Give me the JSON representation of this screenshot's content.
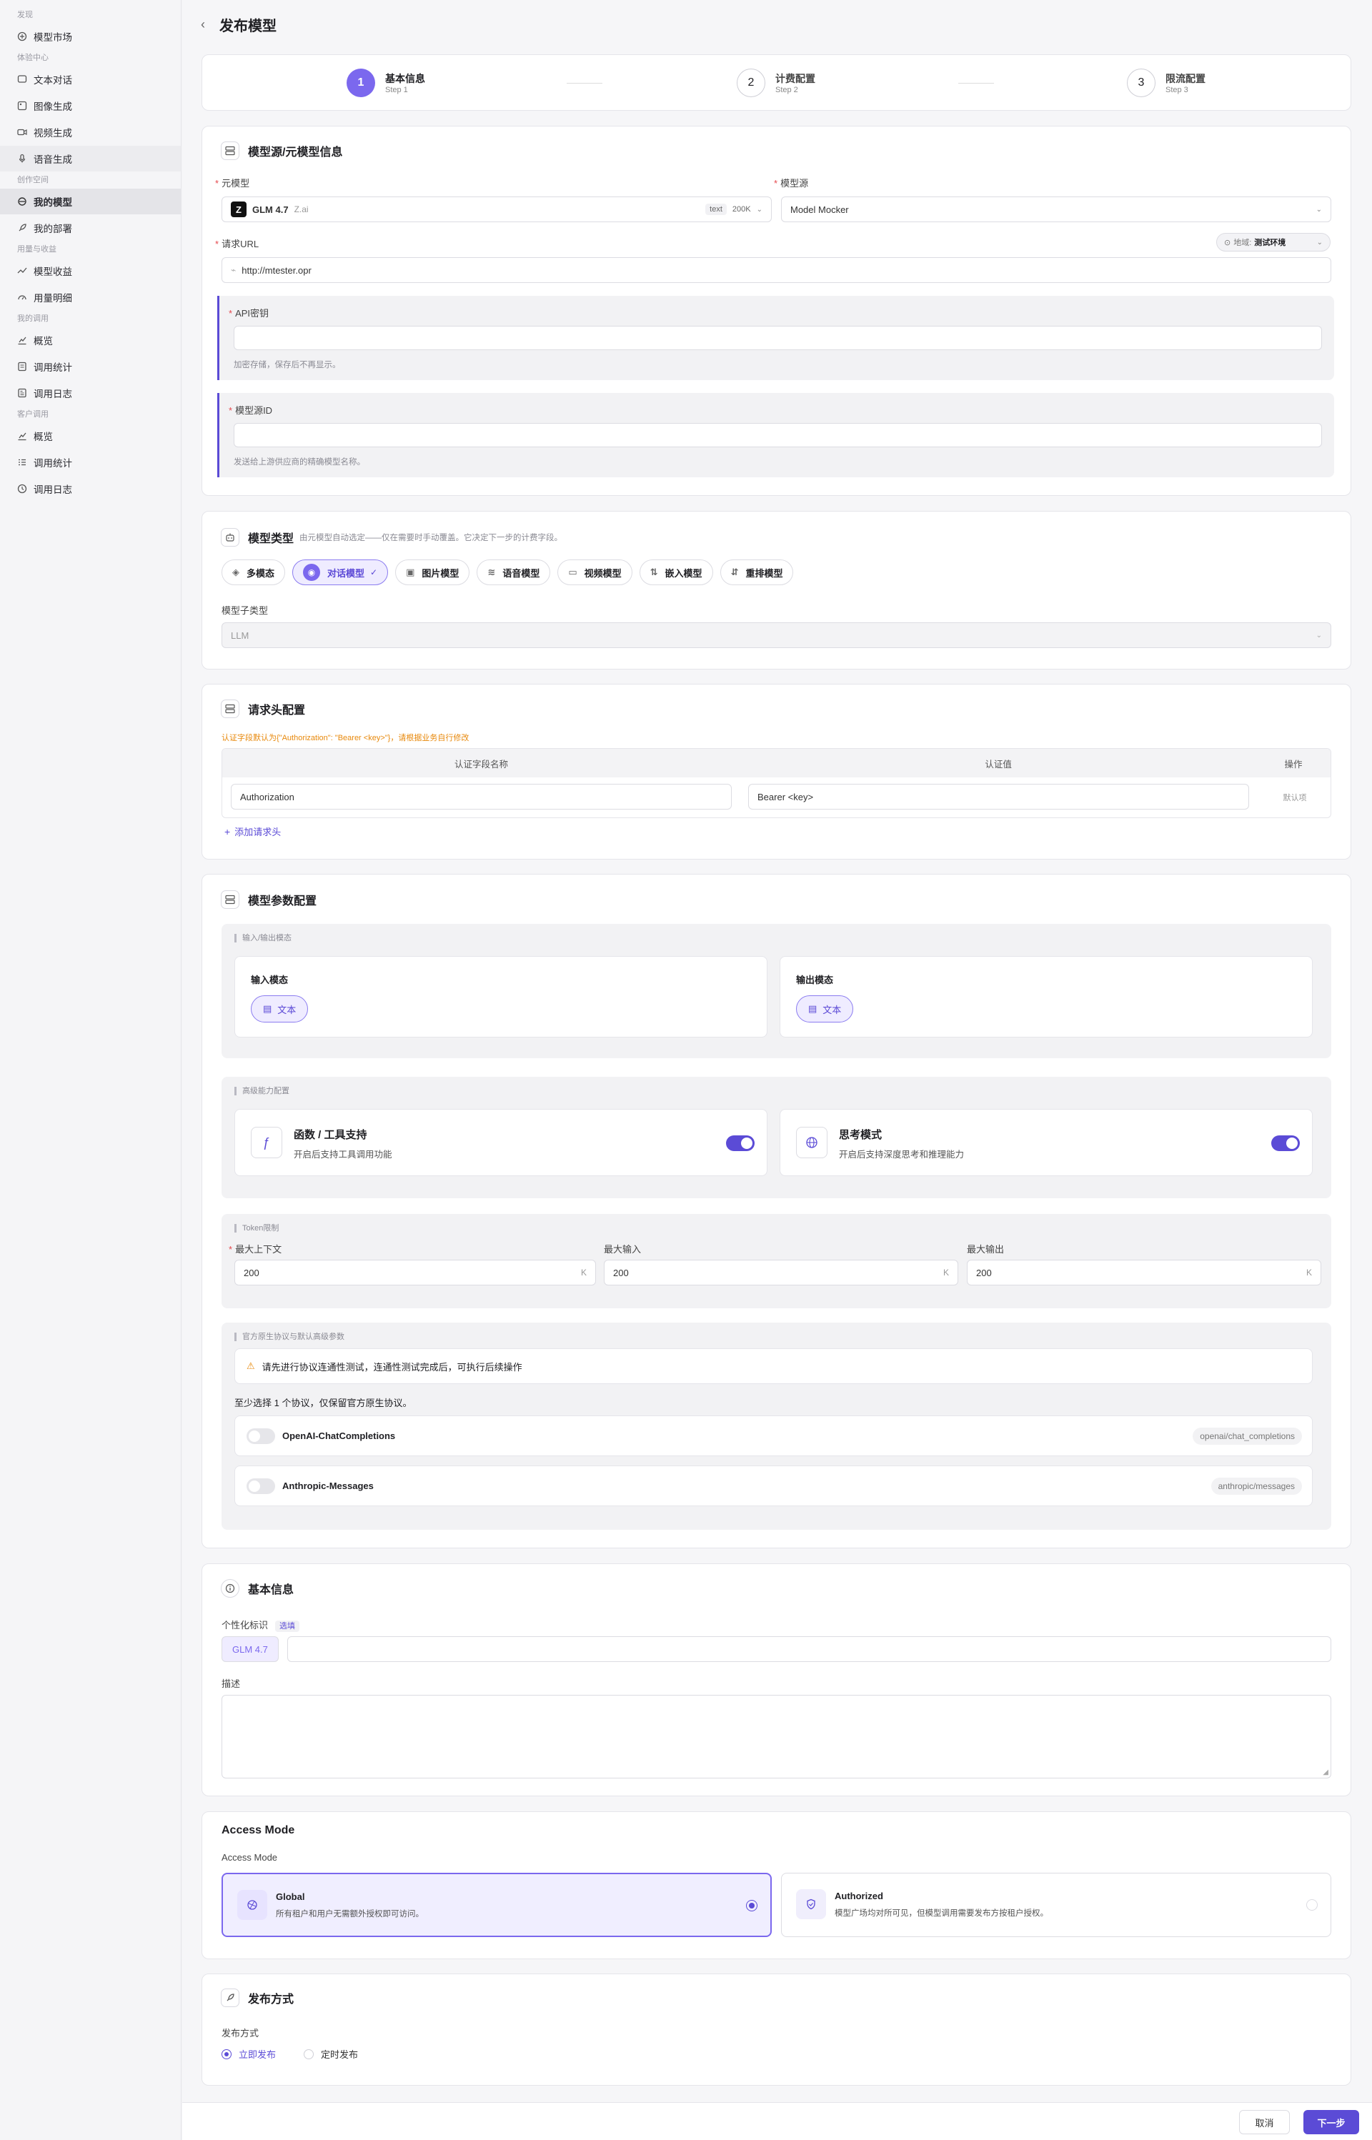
{
  "sidebar": {
    "groups": [
      {
        "label": "发现",
        "items": [
          {
            "label": "模型市场",
            "icon": "market-icon"
          }
        ]
      },
      {
        "label": "体验中心",
        "items": [
          {
            "label": "文本对话",
            "icon": "chat-icon"
          },
          {
            "label": "图像生成",
            "icon": "image-icon"
          },
          {
            "label": "视频生成",
            "icon": "video-icon"
          },
          {
            "label": "语音生成",
            "icon": "mic-icon"
          }
        ]
      },
      {
        "label": "创作空间",
        "items": [
          {
            "label": "我的模型",
            "icon": "model-icon"
          },
          {
            "label": "我的部署",
            "icon": "rocket-icon"
          }
        ]
      },
      {
        "label": "用量与收益",
        "items": [
          {
            "label": "模型收益",
            "icon": "trend-icon"
          },
          {
            "label": "用量明细",
            "icon": "gauge-icon"
          }
        ]
      },
      {
        "label": "我的调用",
        "items": [
          {
            "label": "概览",
            "icon": "chart-icon"
          },
          {
            "label": "调用统计",
            "icon": "table-icon"
          },
          {
            "label": "调用日志",
            "icon": "log-icon"
          }
        ]
      },
      {
        "label": "客户调用",
        "items": [
          {
            "label": "概览",
            "icon": "chart-icon"
          },
          {
            "label": "调用统计",
            "icon": "list-icon"
          },
          {
            "label": "调用日志",
            "icon": "log-icon"
          }
        ]
      }
    ]
  },
  "header": {
    "back": "‹",
    "title": "发布模型"
  },
  "steps": [
    {
      "num": "1",
      "title": "基本信息",
      "sub": "Step 1"
    },
    {
      "num": "2",
      "title": "计费配置",
      "sub": "Step 2"
    },
    {
      "num": "3",
      "title": "限流配置",
      "sub": "Step 3"
    }
  ],
  "source": {
    "title": "模型源/元模型信息",
    "meta_label": "元模型",
    "meta_name": "GLM 4.7",
    "meta_vendor": "Z.ai",
    "meta_tag": "text",
    "meta_ctx": "200K",
    "provider_label": "模型源",
    "provider_value": "Model Mocker",
    "url_label": "请求URL",
    "url_value": "http://mtester.opr",
    "region_prefix": "地域:",
    "region_value": "测试环境",
    "apikey_label": "API密钥",
    "apikey_hint": "加密存储，保存后不再显示。",
    "sourceid_label": "模型源ID",
    "sourceid_hint": "发送给上游供应商的精确模型名称。"
  },
  "model_type": {
    "title": "模型类型",
    "desc": "由元模型自动选定——仅在需要时手动覆盖。它决定下一步的计费字段。",
    "types": [
      {
        "label": "多模态",
        "icon": "multimodal-icon",
        "glyph": "◈"
      },
      {
        "label": "对话模型",
        "icon": "chat-bubble-icon",
        "glyph": "◉"
      },
      {
        "label": "图片模型",
        "icon": "picture-icon",
        "glyph": "▣"
      },
      {
        "label": "语音模型",
        "icon": "audio-wave-icon",
        "glyph": "≋"
      },
      {
        "label": "视频模型",
        "icon": "camera-icon",
        "glyph": "▭"
      },
      {
        "label": "嵌入模型",
        "icon": "embed-icon",
        "glyph": "⇅"
      },
      {
        "label": "重排模型",
        "icon": "rerank-icon",
        "glyph": "⇵"
      }
    ],
    "selected_check": "✓",
    "subtype_label": "模型子类型",
    "subtype_value": "LLM"
  },
  "headers_cfg": {
    "title": "请求头配置",
    "warning": "认证字段默认为{\"Authorization\": \"Bearer <key>\"}，请根据业务自行修改",
    "col_name": "认证字段名称",
    "col_value": "认证值",
    "col_op": "操作",
    "row_name": "Authorization",
    "row_value": "Bearer <key>",
    "row_op": "默认项",
    "add": "添加请求头"
  },
  "params": {
    "title": "模型参数配置",
    "io_tag": "输入/输出模态",
    "input_label": "输入模态",
    "output_label": "输出模态",
    "modality": "文本",
    "adv_tag": "高级能力配置",
    "func_title": "函数 / 工具支持",
    "func_desc": "开启后支持工具调用功能",
    "think_title": "思考模式",
    "think_desc": "开启后支持深度思考和推理能力",
    "token_tag": "Token限制",
    "max_ctx_label": "最大上下文",
    "max_in_label": "最大输入",
    "max_out_label": "最大输出",
    "max_ctx": "200",
    "max_in": "200",
    "max_out": "200",
    "unit": "K",
    "proto_tag": "官方原生协议与默认高级参数",
    "proto_warn": "请先进行协议连通性测试，连通性测试完成后，可执行后续操作",
    "proto_note": "至少选择 1 个协议，仅保留官方原生协议。",
    "protocols": [
      {
        "name": "OpenAI-ChatCompletions",
        "path": "openai/chat_completions"
      },
      {
        "name": "Anthropic-Messages",
        "path": "anthropic/messages"
      }
    ]
  },
  "basic": {
    "title": "基本信息",
    "custom_label": "个性化标识",
    "custom_optional": "选填",
    "prefix": "GLM 4.7",
    "desc_label": "描述"
  },
  "access": {
    "title": "Access Mode",
    "label": "Access Mode",
    "global_title": "Global",
    "global_desc": "所有租户和用户无需额外授权即可访问。",
    "auth_title": "Authorized",
    "auth_desc": "模型广场均对所可见，但模型调用需要发布方按租户授权。"
  },
  "publish": {
    "title": "发布方式",
    "label": "发布方式",
    "now": "立即发布",
    "scheduled": "定时发布"
  },
  "footer": {
    "cancel": "取消",
    "next": "下一步"
  },
  "colors": {
    "accent": "#5b4bd6",
    "accent_light": "#efecff",
    "required": "#e5484d",
    "warning": "#e8890c"
  }
}
